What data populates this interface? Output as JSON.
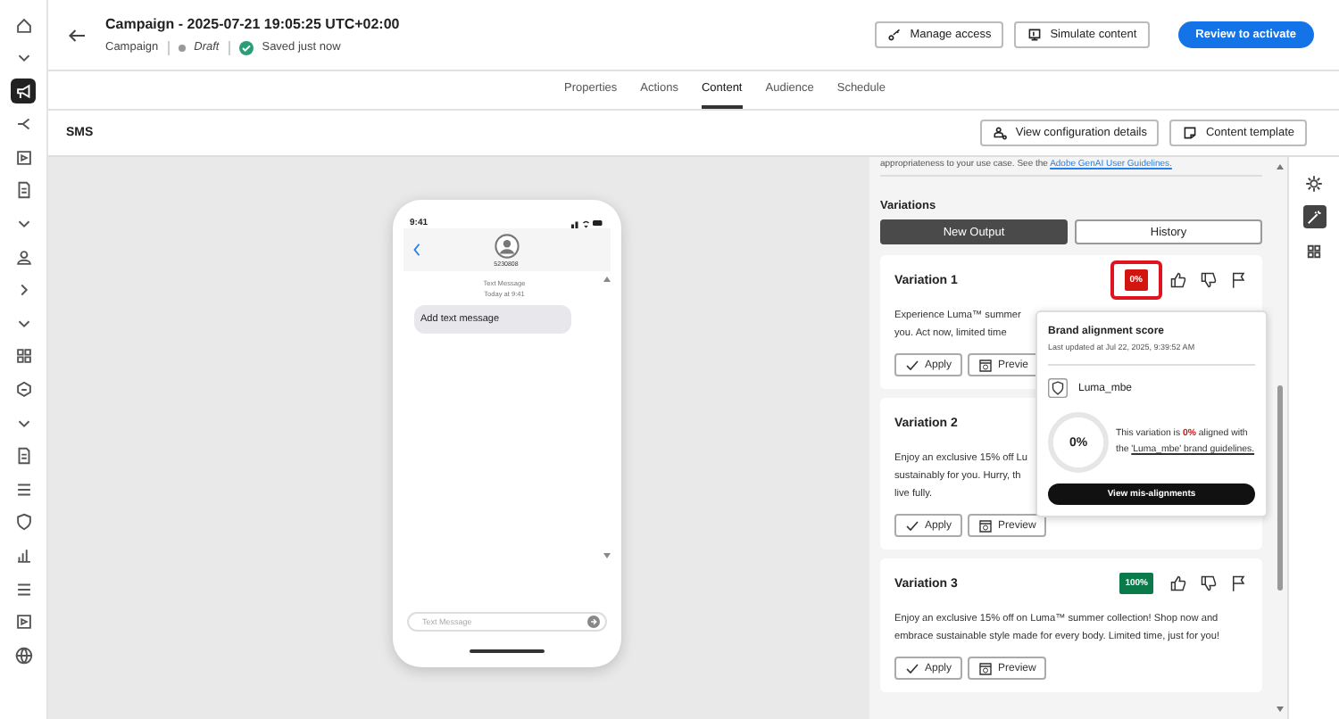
{
  "rail_items": [
    {
      "kind": "home",
      "selected": false
    },
    {
      "kind": "chevron-down",
      "selected": false
    },
    {
      "kind": "megaphone",
      "selected": true
    },
    {
      "kind": "branch",
      "selected": false
    },
    {
      "kind": "media",
      "selected": false
    },
    {
      "kind": "doc",
      "selected": false
    },
    {
      "kind": "chevron-down",
      "selected": false
    },
    {
      "kind": "person",
      "selected": false
    },
    {
      "kind": "chevron-right",
      "selected": false
    },
    {
      "kind": "chevron-down",
      "selected": false
    },
    {
      "kind": "grid",
      "selected": false
    },
    {
      "kind": "badge",
      "selected": false
    },
    {
      "kind": "chevron-down",
      "selected": false
    },
    {
      "kind": "doc",
      "selected": false
    },
    {
      "kind": "list",
      "selected": false
    },
    {
      "kind": "shield",
      "selected": false
    },
    {
      "kind": "chart",
      "selected": false
    },
    {
      "kind": "list",
      "selected": false
    },
    {
      "kind": "media",
      "selected": false
    },
    {
      "kind": "globe",
      "selected": false
    }
  ],
  "header": {
    "title": "Campaign - 2025-07-21 19:05:25 UTC+02:00",
    "type": "Campaign",
    "status": "Draft",
    "saved": "Saved just now",
    "buttons": [
      {
        "label": "Manage access",
        "kind": "key",
        "primary": false
      },
      {
        "label": "Simulate content",
        "kind": "simulate",
        "primary": false
      },
      {
        "label": "Review to activate",
        "kind": "none",
        "primary": true
      }
    ]
  },
  "tabs": [
    {
      "label": "Properties",
      "selected": false
    },
    {
      "label": "Actions",
      "selected": false
    },
    {
      "label": "Content",
      "selected": true
    },
    {
      "label": "Audience",
      "selected": false
    },
    {
      "label": "Schedule",
      "selected": false
    }
  ],
  "channel_bar": {
    "title": "SMS",
    "buttons": [
      {
        "label": "View configuration details",
        "kind": "config"
      },
      {
        "label": "Content template",
        "kind": "template"
      }
    ]
  },
  "phone": {
    "time": "9:41",
    "contact": "5230808",
    "thread_label": "Text Message",
    "thread_time": "Today at 9:41",
    "message": "Add text message",
    "input_placeholder": "Text Message"
  },
  "panel": {
    "notice": "appropriateness to your use case. See the",
    "notice_link": "Adobe GenAI User Guidelines.",
    "section": "Variations",
    "toggles": [
      {
        "label": "New Output",
        "selected": true
      },
      {
        "label": "History",
        "selected": false
      }
    ],
    "variations": [
      {
        "title": "Variation 1",
        "score": "0%",
        "color": "#d3150f",
        "highlighted": true,
        "actions_visible": true,
        "lines": [
          "Experience Luma™ summer",
          "you. Act now, limited time"
        ],
        "apply": "Apply",
        "preview": "Previe"
      },
      {
        "title": "Variation 2",
        "lines": [
          "Enjoy an exclusive 15% off Lu",
          "sustainably for you. Hurry, th",
          "live fully."
        ],
        "apply": "Apply",
        "preview": "Preview"
      },
      {
        "title": "Variation 3",
        "score": "100%",
        "color": "#0b7a4a",
        "highlighted": false,
        "actions_visible": true,
        "lines": [
          "Enjoy an exclusive 15% off on Luma™ summer collection! Shop now and",
          "embrace sustainable style made for every body. Limited time, just for you!"
        ],
        "apply": "Apply",
        "preview": "Preview"
      }
    ]
  },
  "popover": {
    "title": "Brand alignment score",
    "updated": "Last updated at Jul 22, 2025, 9:39:52 AM",
    "brand": "Luma_mbe",
    "ring_value": "0%",
    "sentence": "This variation is **0%** aligned with the",
    "link": "'Luma_mbe' brand guidelines.",
    "button": "View mis-alignments"
  },
  "right_rail": [
    {
      "kind": "gear",
      "selected": false
    },
    {
      "kind": "wand",
      "selected": true
    },
    {
      "kind": "grid",
      "selected": false
    }
  ]
}
